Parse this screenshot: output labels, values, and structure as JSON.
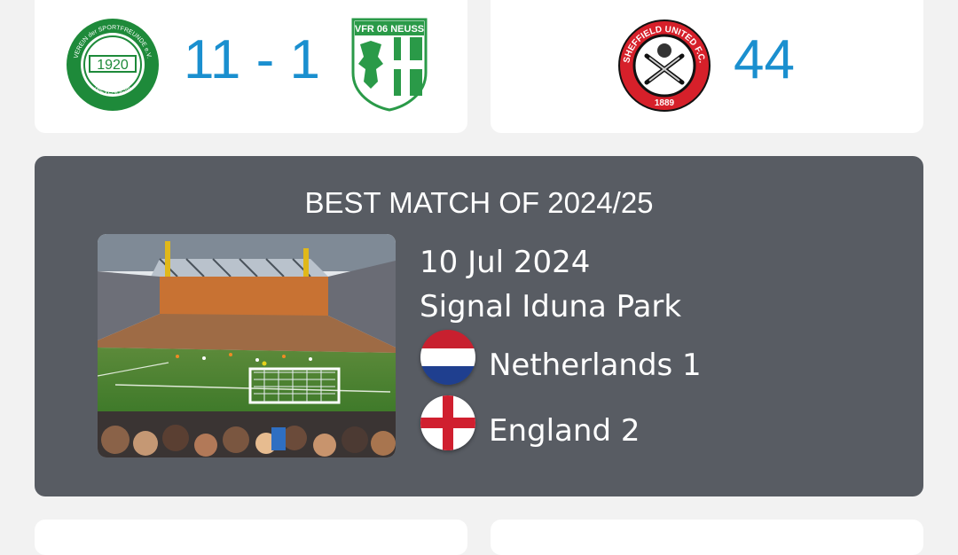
{
  "top_left": {
    "home_crest": {
      "icon": "vds-nievenheim-crest",
      "year": "1920",
      "ring_top": "VEREIN der SPORTFREUNDE e.V.",
      "ring_bottom": "NIEVENHEIM",
      "color": "#1e8a3a"
    },
    "score": "11 - 1",
    "away_crest": {
      "icon": "vfr-neuss-crest",
      "label": "VFR 06 NEUSS",
      "color": "#2a9a48"
    }
  },
  "top_right": {
    "crest": {
      "icon": "sheffield-united-crest",
      "ring_text": "SHEFFIELD UNITED F.C.",
      "year": "1889",
      "color": "#d6202a"
    },
    "value": "44"
  },
  "best_match": {
    "title": "BEST MATCH OF 2024/25",
    "photo": "stadium-photo",
    "date": "10 Jul 2024",
    "venue": "Signal Iduna Park",
    "home": {
      "flag": "netherlands-flag",
      "text": "Netherlands 1"
    },
    "away": {
      "flag": "england-flag",
      "text": "England 2"
    }
  },
  "colors": {
    "accent": "#1a8fcf",
    "card_dark": "#585c63",
    "background": "#f2f2f2"
  }
}
